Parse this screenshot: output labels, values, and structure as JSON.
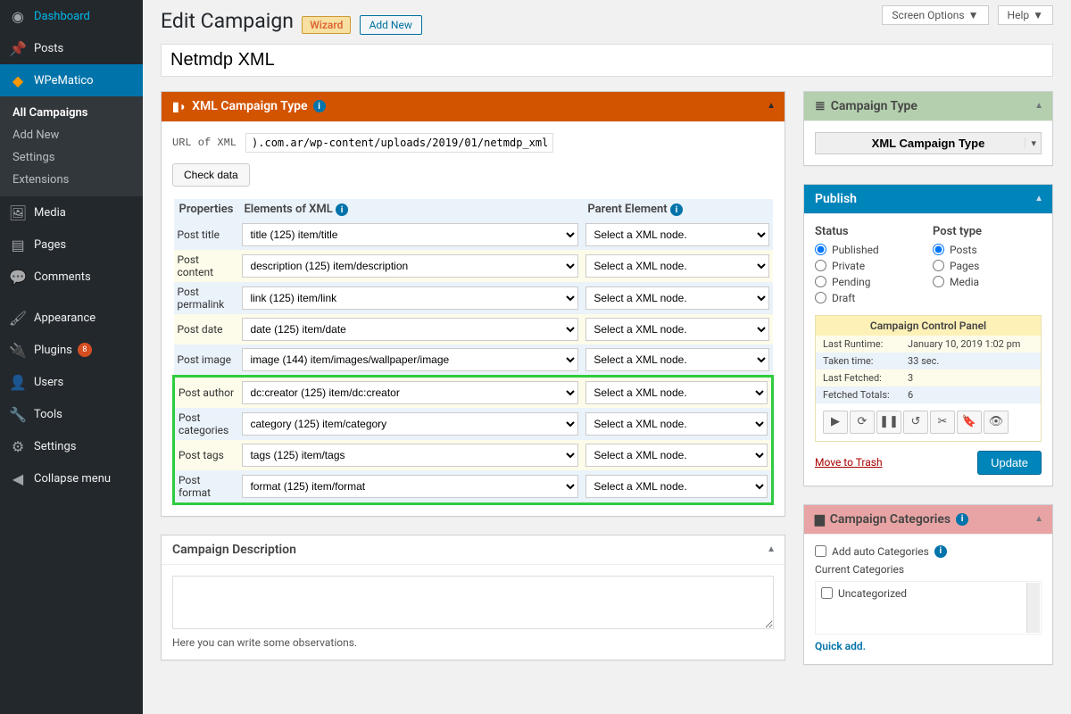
{
  "topbar": {
    "screen_options": "Screen Options",
    "help": "Help"
  },
  "page": {
    "title": "Edit Campaign",
    "wizard": "Wizard",
    "add_new": "Add New",
    "campaign_name": "Netmdp XML"
  },
  "sidebar": {
    "items": [
      {
        "label": "Dashboard"
      },
      {
        "label": "Posts"
      },
      {
        "label": "WPeMatico"
      },
      {
        "label": "Media"
      },
      {
        "label": "Pages"
      },
      {
        "label": "Comments"
      },
      {
        "label": "Appearance"
      },
      {
        "label": "Plugins",
        "badge": "8"
      },
      {
        "label": "Users"
      },
      {
        "label": "Tools"
      },
      {
        "label": "Settings"
      },
      {
        "label": "Collapse menu"
      }
    ],
    "sub": [
      "All Campaigns",
      "Add New",
      "Settings",
      "Extensions"
    ]
  },
  "xmlbox": {
    "title": "XML Campaign Type",
    "url_label": "URL of XML",
    "url_value": ").com.ar/wp-content/uploads/2019/01/netmdp_xml.xml",
    "check_btn": "Check data",
    "headers": {
      "props": "Properties",
      "elements": "Elements of XML",
      "parent": "Parent Element"
    },
    "parent_placeholder": "Select a XML node.",
    "rows": [
      {
        "label": "Post title",
        "element": "title (125) item/title"
      },
      {
        "label": "Post content",
        "element": "description (125) item/description"
      },
      {
        "label": "Post permalink",
        "element": "link (125) item/link"
      },
      {
        "label": "Post date",
        "element": "date (125) item/date"
      },
      {
        "label": "Post image",
        "element": "image (144) item/images/wallpaper/image"
      },
      {
        "label": "Post author",
        "element": "dc:creator (125) item/dc:creator"
      },
      {
        "label": "Post categories",
        "element": "category (125) item/category"
      },
      {
        "label": "Post tags",
        "element": "tags (125) item/tags"
      },
      {
        "label": "Post format",
        "element": "format (125) item/format"
      }
    ]
  },
  "descbox": {
    "title": "Campaign Description",
    "hint": "Here you can write some observations."
  },
  "side_ct": {
    "title": "Campaign Type",
    "value": "XML Campaign Type"
  },
  "publish": {
    "title": "Publish",
    "status_label": "Status",
    "posttype_label": "Post type",
    "statuses": [
      "Published",
      "Private",
      "Pending",
      "Draft"
    ],
    "status_selected": "Published",
    "posttypes": [
      "Posts",
      "Pages",
      "Media"
    ],
    "posttype_selected": "Posts",
    "ccp_title": "Campaign Control Panel",
    "ccp_rows": [
      {
        "k": "Last Runtime:",
        "v": "January 10, 2019 1:02 pm"
      },
      {
        "k": "Taken time:",
        "v": "33 sec."
      },
      {
        "k": "Last Fetched:",
        "v": "3"
      },
      {
        "k": "Fetched Totals:",
        "v": "6"
      }
    ],
    "trash": "Move to Trash",
    "update": "Update"
  },
  "catbox": {
    "title": "Campaign Categories",
    "auto_label": "Add auto Categories",
    "current_label": "Current Categories",
    "uncat": "Uncategorized",
    "quick": "Quick add."
  }
}
